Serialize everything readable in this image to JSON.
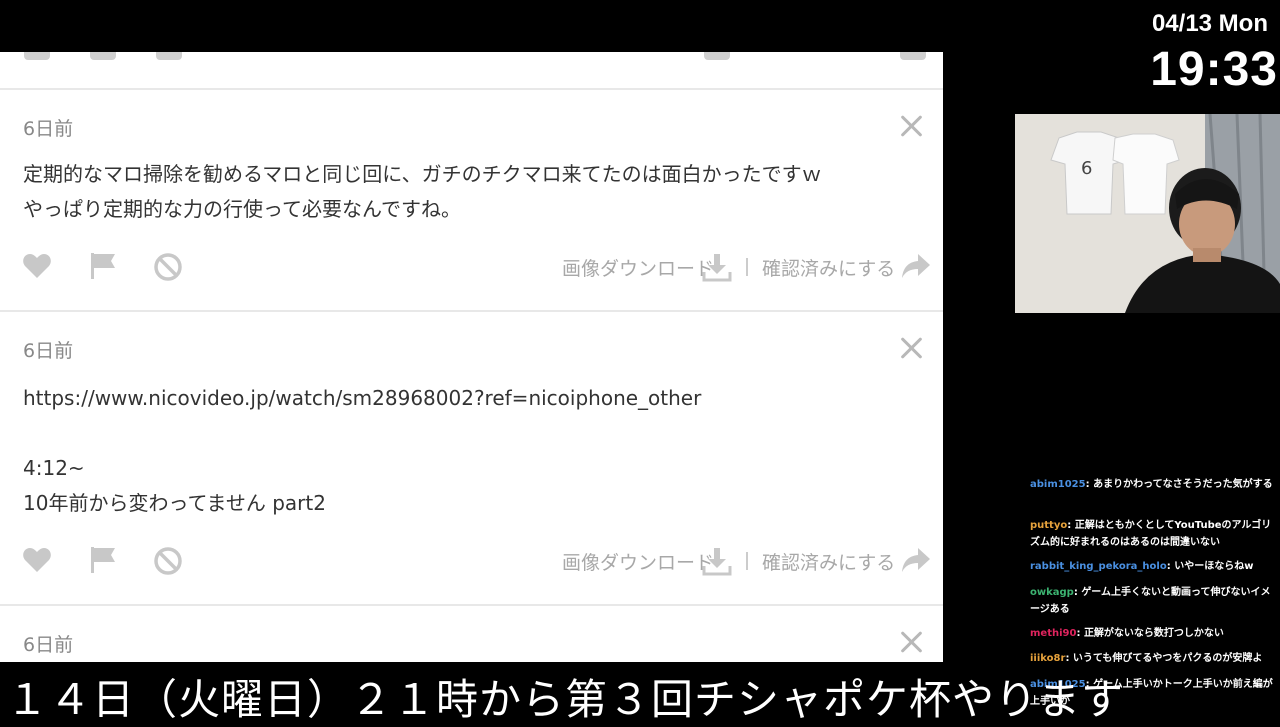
{
  "overlay": {
    "date": "04/13 Mon",
    "time": "19:33",
    "ticker": "１４日（火曜日）２１時から第３回チシャポケ杯やります"
  },
  "cards": [
    {
      "time": "6日前",
      "body": "定期的なマロ掃除を勧めるマロと同じ回に、ガチのチクマロ来てたのは面白かったですｗ\nやっぱり定期的な力の行使って必要なんですね。"
    },
    {
      "time": "6日前",
      "body": "https://www.nicovideo.jp/watch/sm28968002?ref=nicoiphone_other\n\n4:12~\n10年前から変わってません part2"
    },
    {
      "time": "6日前",
      "body": ""
    }
  ],
  "actions": {
    "download_label": "画像ダウンロード",
    "confirm_label": "確認済みにする"
  },
  "chat": [
    {
      "user": "abim1025",
      "color": "#4a90e2",
      "text": "あまりかわってなさそうだった気がする"
    },
    {
      "user": "puttyo",
      "color": "#e6a23c",
      "text": "正解はともかくとしてYouTubeのアルゴリズム的に好まれるのはあるのは間違いない"
    },
    {
      "user": "rabbit_king_pekora_holo",
      "color": "#4a90e2",
      "text": "いやーほならねw"
    },
    {
      "user": "owkagp",
      "color": "#3cb371",
      "text": "ゲーム上手くないと動画って伸びないイメージある"
    },
    {
      "user": "methi90",
      "color": "#e0245e",
      "text": "正解がないなら数打つしかない"
    },
    {
      "user": "iiiko8r",
      "color": "#e6a23c",
      "text": "いうても伸びてるやつをパクるのが安牌よ"
    },
    {
      "user": "abim1025",
      "color": "#4a90e2",
      "text": "ゲーム上手いかトーク上手いか前え編が上手いか"
    }
  ],
  "icons": {
    "heart": "heart-icon",
    "flag": "flag-icon",
    "block": "block-icon",
    "download": "download-icon",
    "forward": "forward-icon",
    "close": "close-icon"
  }
}
